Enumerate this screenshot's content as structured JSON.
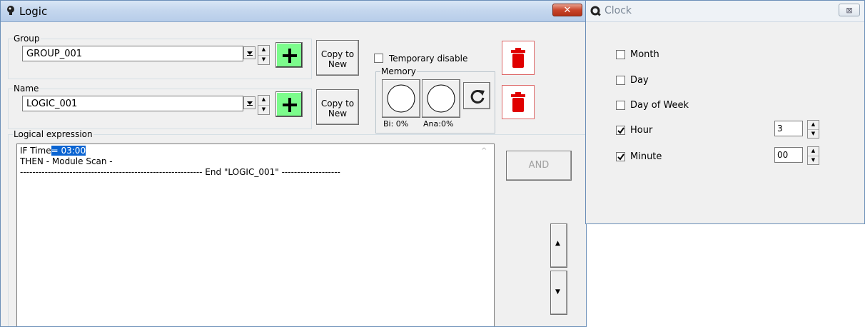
{
  "logic_window": {
    "title": "Logic",
    "close_label": "✕",
    "group": {
      "legend": "Group",
      "value": "GROUP_001",
      "copy_label_1": "Copy to",
      "copy_label_2": "New"
    },
    "name": {
      "legend": "Name",
      "value": "LOGIC_001",
      "copy_label_1": "Copy to",
      "copy_label_2": "New"
    },
    "temporary_disable": {
      "label": "Temporary disable",
      "checked": false
    },
    "memory": {
      "legend": "Memory",
      "bi_label": "Bi: 0%",
      "ana_label": "Ana:0%"
    },
    "logical_expression": {
      "legend": "Logical expression",
      "line1_prefix": "IF Time",
      "line1_selected": "= 03:00",
      "line2": "THEN - Module Scan -",
      "line3": "----------------------------------------------------------- End \"LOGIC_001\" -------------------"
    },
    "and_button": "AND",
    "up_arrow": "▲",
    "down_arrow": "▼"
  },
  "clock_window": {
    "title": "Clock",
    "close_label": "⊠",
    "rows": [
      {
        "label": "Month",
        "checked": false
      },
      {
        "label": "Day",
        "checked": false
      },
      {
        "label": "Day of Week",
        "checked": false
      },
      {
        "label": "Hour",
        "checked": true,
        "value": "3"
      },
      {
        "label": "Minute",
        "checked": true,
        "value": "00"
      }
    ]
  },
  "icons": {
    "logic_icon": "bulb-icon",
    "clock_icon": "magnifier-icon",
    "add_icon": "plus-icon",
    "delete_icon": "trash-icon",
    "refresh_icon": "refresh-icon"
  },
  "colors": {
    "add_button": "#7cfc8c",
    "delete_icon": "#e00000",
    "selection": "#0a64d2"
  }
}
